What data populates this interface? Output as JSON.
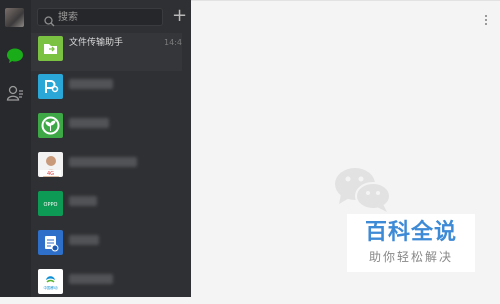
{
  "search": {
    "placeholder": "搜索"
  },
  "chats": [
    {
      "name": "文件传输助手",
      "time": "14:4",
      "avatar_color": "#7cc242",
      "avatar_icon": "folder-icon"
    },
    {
      "name": "",
      "avatar_color": "#2aa7d6",
      "avatar_icon": "p-logo-icon"
    },
    {
      "name": "",
      "avatar_color": "#3da845",
      "avatar_icon": "plant-logo-icon"
    },
    {
      "name": "",
      "avatar_color": "#f2f2f2",
      "avatar_icon": "photo-4g-icon",
      "avatar_text": "4G"
    },
    {
      "name": "",
      "avatar_color": "#0d9a54",
      "avatar_icon": "oppo-logo-icon",
      "avatar_text": "OPPO"
    },
    {
      "name": "",
      "avatar_color": "#2d6fc9",
      "avatar_icon": "document-check-icon"
    },
    {
      "name": "",
      "avatar_color": "#ffffff",
      "avatar_icon": "china-mobile-icon",
      "avatar_text": "中国移动"
    }
  ],
  "watermark": {
    "title": "百科全说",
    "subtitle": "助你轻松解决"
  },
  "colors": {
    "nav_bg": "#27292c",
    "list_bg": "#2f3033",
    "main_bg": "#f4f4f4",
    "watermark_blue": "#3d8ad6"
  }
}
